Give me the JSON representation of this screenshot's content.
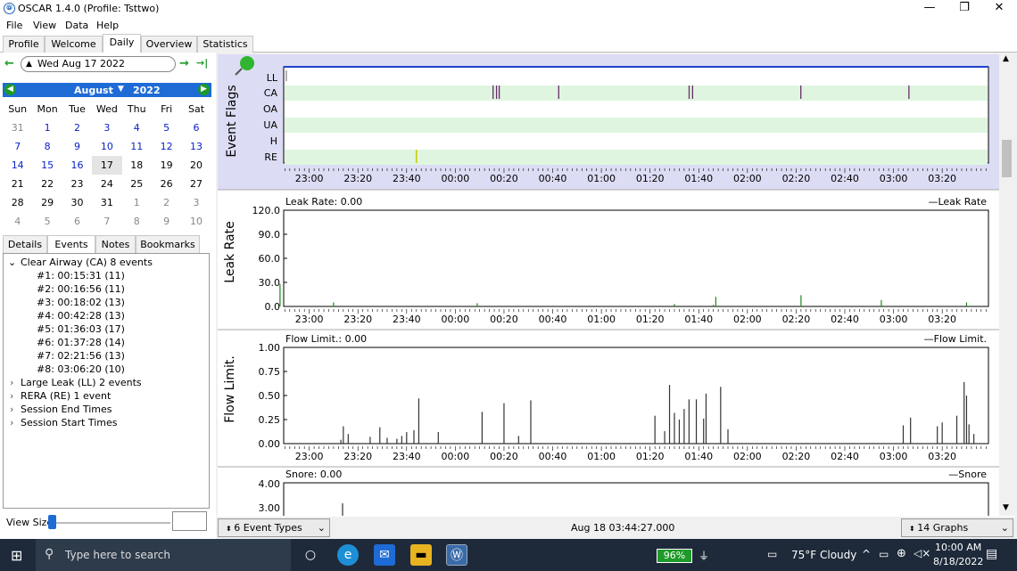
{
  "window": {
    "title": "OSCAR 1.4.0 (Profile: Tsttwo)",
    "minimize": "—",
    "maximize": "❐",
    "close": "✕"
  },
  "menu": [
    "File",
    "View",
    "Data",
    "Help"
  ],
  "tabs": [
    "Profile",
    "Welcome",
    "Daily",
    "Overview",
    "Statistics"
  ],
  "date_nav": {
    "date": "Wed Aug 17 2022",
    "back": "←",
    "forward": "→",
    "last": "→|"
  },
  "calendar": {
    "month": "August",
    "year": "2022",
    "weekdays": [
      "Sun",
      "Mon",
      "Tue",
      "Wed",
      "Thu",
      "Fri",
      "Sat"
    ],
    "weeks": [
      [
        "31",
        "1",
        "2",
        "3",
        "4",
        "5",
        "6"
      ],
      [
        "7",
        "8",
        "9",
        "10",
        "11",
        "12",
        "13"
      ],
      [
        "14",
        "15",
        "16",
        "17",
        "18",
        "19",
        "20"
      ],
      [
        "21",
        "22",
        "23",
        "24",
        "25",
        "26",
        "27"
      ],
      [
        "28",
        "29",
        "30",
        "31",
        "1",
        "2",
        "3"
      ],
      [
        "4",
        "5",
        "6",
        "7",
        "8",
        "9",
        "10"
      ]
    ]
  },
  "left_tabs": [
    "Details",
    "Events",
    "Notes",
    "Bookmarks"
  ],
  "events_tree": {
    "ca_header": "Clear Airway (CA) 8 events",
    "ca_items": [
      "#1: 00:15:31 (11)",
      "#2: 00:16:56 (11)",
      "#3: 00:18:02 (13)",
      "#4: 00:42:28 (13)",
      "#5: 01:36:03 (17)",
      "#6: 01:37:28 (14)",
      "#7: 02:21:56 (13)",
      "#8: 03:06:20 (10)"
    ],
    "other": [
      "Large Leak (LL) 2 events",
      "RERA (RE) 1 event",
      "Session End Times",
      "Session Start Times"
    ]
  },
  "view_size_label": "View Size",
  "time_ticks": [
    "23:00",
    "23:20",
    "23:40",
    "00:00",
    "00:20",
    "00:40",
    "01:00",
    "01:20",
    "01:40",
    "02:00",
    "02:20",
    "02:40",
    "03:00",
    "03:20"
  ],
  "event_flags": {
    "ylabel": "Event Flags",
    "rows": [
      "LL",
      "CA",
      "OA",
      "UA",
      "H",
      "RE"
    ]
  },
  "leak": {
    "header": "Leak Rate: 0.00",
    "legend": "Leak Rate",
    "ylabel": "Leak Rate",
    "yticks": [
      "120.0",
      "90.0",
      "60.0",
      "30.0",
      "0.0"
    ]
  },
  "flow": {
    "header": "Flow Limit.: 0.00",
    "legend": "Flow Limit.",
    "ylabel": "Flow Limit.",
    "yticks": [
      "1.00",
      "0.75",
      "0.50",
      "0.25",
      "0.00"
    ]
  },
  "snore": {
    "header": "Snore: 0.00",
    "legend": "Snore",
    "yticks": [
      "4.00",
      "3.00"
    ]
  },
  "bottom": {
    "event_types": "6 Event Types",
    "timestamp": "Aug 18 03:44:27.000",
    "graphs": "14 Graphs"
  },
  "taskbar": {
    "search_placeholder": "Type here to search",
    "battery": "96%",
    "weather": "75°F  Cloudy",
    "time": "10:00 AM",
    "date": "8/18/2022"
  },
  "colors": {
    "accent": "#1e6bd6",
    "flag_stripe": "#dff5df",
    "leak_line": "#1a8a1a",
    "ca_mark": "#6a2a6a",
    "re_mark": "#c8c800"
  },
  "chart_data": [
    {
      "type": "scatter",
      "title": "Event Flags",
      "categories": [
        "LL",
        "CA",
        "OA",
        "UA",
        "H",
        "RE"
      ],
      "series": [
        {
          "name": "CA",
          "x": [
            "00:15:31",
            "00:16:56",
            "00:18:02",
            "00:42:28",
            "01:36:03",
            "01:37:28",
            "02:21:56",
            "03:06:20"
          ]
        },
        {
          "name": "RE",
          "x": [
            "23:44"
          ]
        }
      ]
    },
    {
      "type": "line",
      "title": "Leak Rate",
      "ylim": [
        0,
        120
      ],
      "series": [
        {
          "name": "Leak Rate",
          "x": [
            "22:45",
            "22:48",
            "23:10",
            "00:09",
            "01:30",
            "01:46",
            "01:47",
            "02:22",
            "02:55",
            "03:30"
          ],
          "values": [
            0,
            28,
            5,
            4,
            3,
            2,
            12,
            14,
            8,
            5
          ]
        }
      ]
    },
    {
      "type": "bar",
      "title": "Flow Limit.",
      "ylim": [
        0,
        1
      ],
      "series": [
        {
          "name": "Flow Limit.",
          "x": [
            "23:13",
            "23:14",
            "23:16",
            "23:25",
            "23:29",
            "23:32",
            "23:36",
            "23:38",
            "23:40",
            "23:43",
            "23:45",
            "23:53",
            "00:11",
            "00:20",
            "00:26",
            "00:31",
            "01:22",
            "01:26",
            "01:28",
            "01:30",
            "01:32",
            "01:34",
            "01:36",
            "01:39",
            "01:42",
            "01:43",
            "01:49",
            "01:52",
            "03:04",
            "03:07",
            "03:18",
            "03:20",
            "03:26",
            "03:29",
            "03:30",
            "03:31",
            "03:33"
          ],
          "values": [
            0.04,
            0.18,
            0.1,
            0.07,
            0.17,
            0.06,
            0.05,
            0.08,
            0.12,
            0.14,
            0.47,
            0.12,
            0.33,
            0.42,
            0.08,
            0.45,
            0.29,
            0.13,
            0.61,
            0.32,
            0.25,
            0.36,
            0.46,
            0.46,
            0.26,
            0.52,
            0.59,
            0.15,
            0.19,
            0.27,
            0.18,
            0.22,
            0.29,
            0.64,
            0.5,
            0.2,
            0.1
          ]
        }
      ]
    }
  ]
}
